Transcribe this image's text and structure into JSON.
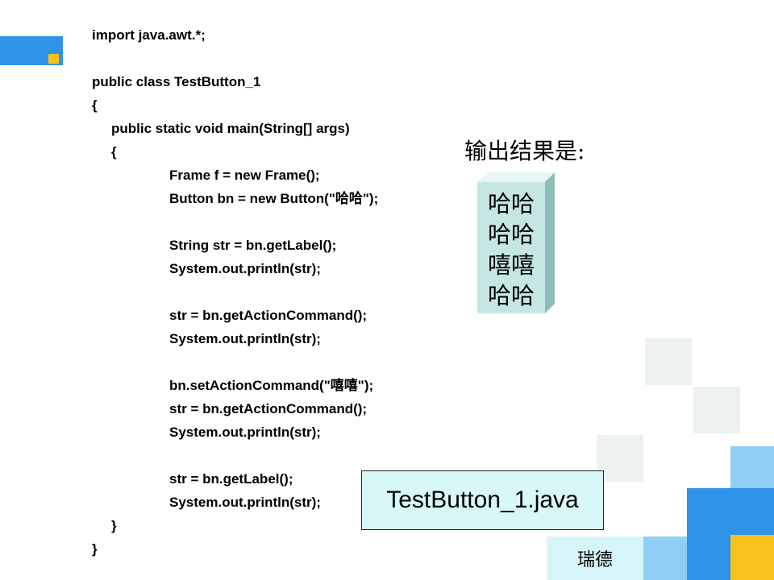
{
  "code": {
    "lines": [
      "import java.awt.*;",
      "",
      "public class TestButton_1",
      "{",
      "public static void main(String[] args)",
      "{",
      "Frame f = new Frame();",
      "Button bn = new Button(\"哈哈\");",
      "",
      "String str = bn.getLabel();",
      "System.out.println(str);",
      "",
      "str = bn.getActionCommand();",
      "System.out.println(str);",
      "",
      "bn.setActionCommand(\"嘻嘻\");",
      "str = bn.getActionCommand();",
      "System.out.println(str);",
      "",
      "str = bn.getLabel();",
      "System.out.println(str);",
      "}",
      "}"
    ]
  },
  "output": {
    "heading": "输出结果是:",
    "lines": [
      "哈哈",
      "哈哈",
      "嘻嘻",
      "哈哈"
    ]
  },
  "file_box": {
    "name": "TestButton_1.java"
  },
  "footer": {
    "label": "瑞德"
  },
  "colors": {
    "accent_blue": "#2f93e8",
    "accent_yellow": "#f7c21a",
    "light_blue": "#8fcff5",
    "output_box": "#c5e7e4",
    "file_box": "#d8f8f8"
  }
}
